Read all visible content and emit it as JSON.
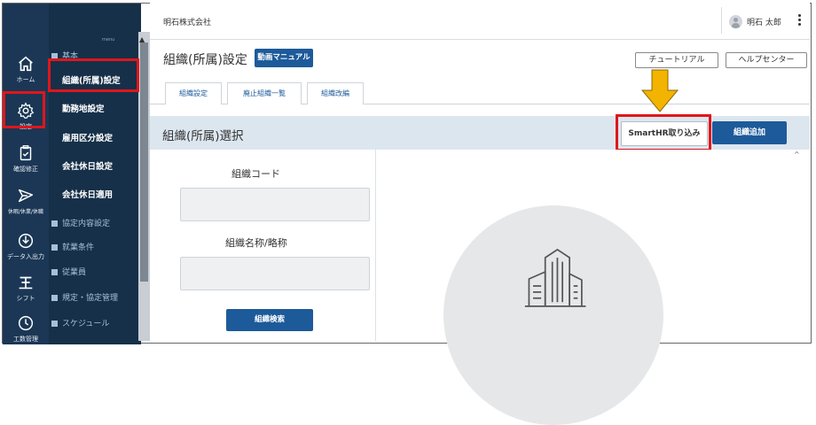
{
  "header": {
    "company": "明石株式会社",
    "user_name": "明石 太郎"
  },
  "rail": [
    {
      "label": "ホーム",
      "icon": "home-icon"
    },
    {
      "label": "設定",
      "icon": "gear-icon"
    },
    {
      "label": "確認修正",
      "icon": "clipboard-icon"
    },
    {
      "label": "休暇/休業/休職",
      "icon": "plane-icon"
    },
    {
      "label": "データ入出力",
      "icon": "download-icon"
    },
    {
      "label": "シフト",
      "icon": "shift-icon"
    },
    {
      "label": "工数管理",
      "icon": "clock-icon"
    }
  ],
  "subnav": {
    "tiny_text": "menu",
    "sections": [
      "基本",
      "協定内容設定",
      "就業条件",
      "従業員",
      "規定・協定管理",
      "スケジュール"
    ],
    "items": [
      "組織(所属)設定",
      "勤務地設定",
      "雇用区分設定",
      "会社休日設定",
      "会社休日適用"
    ]
  },
  "page": {
    "title": "組織(所属)設定",
    "manual_button": "動画マニュアル",
    "tutorial_button": "チュートリアル",
    "help_button": "ヘルプセンター",
    "tabs": [
      "組織設定",
      "廃止組織一覧",
      "組織改編"
    ]
  },
  "panel": {
    "title": "組織(所属)選択",
    "smarthr_button": "SmartHR取り込み",
    "add_button": "組織追加",
    "code_label": "組織コード",
    "name_label": "組織名称/略称",
    "search_button": "組織検索"
  },
  "colors": {
    "sidebar": "#1b3755",
    "accent": "#1d5a9a",
    "highlight": "#e0161b",
    "arrow": "#f2b400"
  }
}
